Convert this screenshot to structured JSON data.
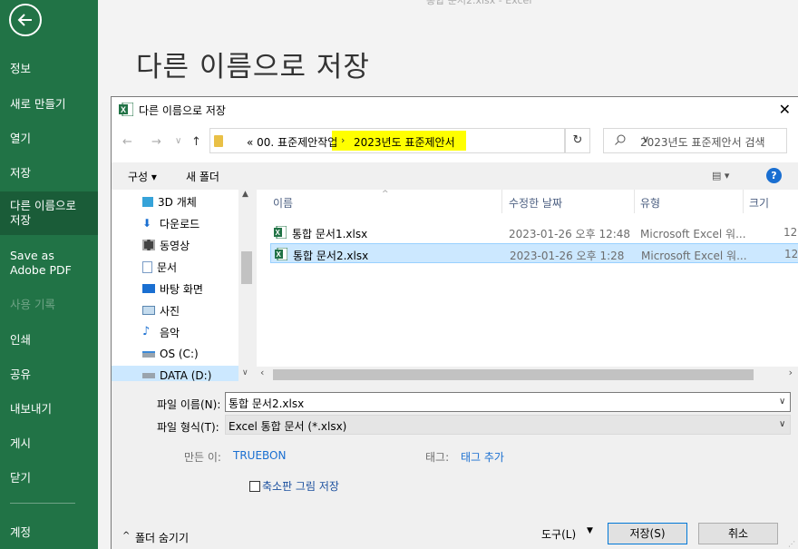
{
  "bg_top_text": "통합 문서2.xlsx - Excel",
  "sidebar": {
    "items": [
      {
        "label": "정보"
      },
      {
        "label": "새로 만들기"
      },
      {
        "label": "열기"
      },
      {
        "label": "저장"
      },
      {
        "label": "다른 이름으로 저장"
      },
      {
        "label": "Save as Adobe PDF"
      },
      {
        "label": "사용 기록"
      },
      {
        "label": "인쇄"
      },
      {
        "label": "공유"
      },
      {
        "label": "내보내기"
      },
      {
        "label": "게시"
      },
      {
        "label": "닫기"
      },
      {
        "label": "계정"
      }
    ]
  },
  "page_title": "다른 이름으로 저장",
  "dialog": {
    "title": "다른 이름으로 저장",
    "close": "✕",
    "address": {
      "crumb1": "« 00. 표준제안작업",
      "separator": "›",
      "crumb2": "2023년도 표준제안서"
    },
    "search_placeholder": "2023년도 표준제안서 검색",
    "toolbar": {
      "organize": "구성 ▾",
      "new_folder": "새 폴더",
      "view": "▤ ▾",
      "help": "?"
    },
    "tree": [
      {
        "label": "3D 개체"
      },
      {
        "label": "다운로드"
      },
      {
        "label": "동영상"
      },
      {
        "label": "문서"
      },
      {
        "label": "바탕 화면"
      },
      {
        "label": "사진"
      },
      {
        "label": "음악"
      },
      {
        "label": "OS (C:)"
      },
      {
        "label": "DATA (D:)"
      }
    ],
    "columns": [
      "이름",
      "수정한 날짜",
      "유형",
      "크기"
    ],
    "files": [
      {
        "name": "통합 문서1.xlsx",
        "date": "2023-01-26 오후 12:48",
        "type": "Microsoft Excel 워...",
        "size": "12"
      },
      {
        "name": "통합 문서2.xlsx",
        "date": "2023-01-26 오후 1:28",
        "type": "Microsoft Excel 워...",
        "size": "12"
      }
    ],
    "form": {
      "filename_label": "파일 이름(N):",
      "filename_value": "통합 문서2.xlsx",
      "filetype_label": "파일 형식(T):",
      "filetype_value": "Excel 통합 문서 (*.xlsx)",
      "author_label": "만든 이:",
      "author_value": "TRUEBON",
      "tags_label": "태그:",
      "tags_value": "태그 추가",
      "thumbnail_label": "축소판 그림 저장",
      "hide_folders": "폴더 숨기기",
      "tools": "도구(L)",
      "save": "저장(S)",
      "cancel": "취소"
    }
  },
  "colors": {
    "excel_green": "#217346",
    "highlight": "#ffff00",
    "selection": "#cce8ff"
  }
}
